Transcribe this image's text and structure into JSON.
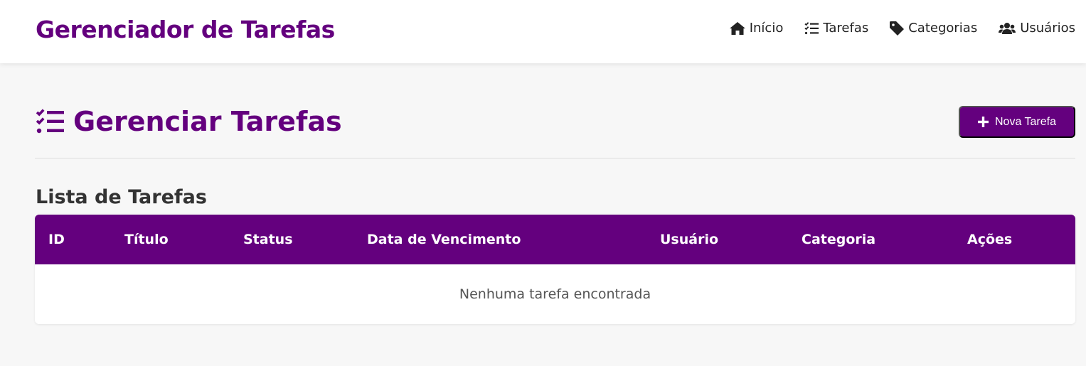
{
  "navbar": {
    "brand": "Gerenciador de Tarefas",
    "links": [
      {
        "label": "Início",
        "icon": "home-icon"
      },
      {
        "label": "Tarefas",
        "icon": "tasks-icon"
      },
      {
        "label": "Categorias",
        "icon": "tag-icon"
      },
      {
        "label": "Usuários",
        "icon": "users-icon"
      }
    ]
  },
  "page": {
    "title": "Gerenciar Tarefas",
    "title_icon": "tasks-icon",
    "new_button_label": "Nova Tarefa",
    "new_button_icon": "plus-icon"
  },
  "task_list": {
    "title": "Lista de Tarefas",
    "columns": [
      "ID",
      "Título",
      "Status",
      "Data de Vencimento",
      "Usuário",
      "Categoria",
      "Ações"
    ],
    "rows": [],
    "empty_message": "Nenhuma tarefa encontrada"
  },
  "colors": {
    "accent": "#64007e",
    "background": "#f7f7f7",
    "navbar_background": "#ffffff"
  }
}
